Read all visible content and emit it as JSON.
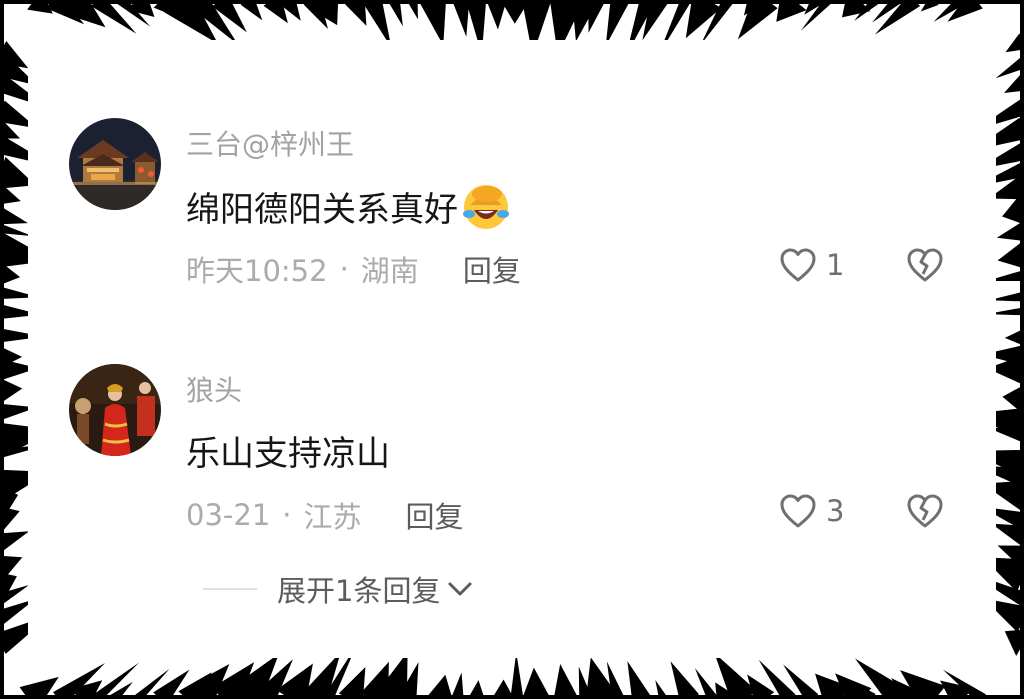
{
  "comments": [
    {
      "username": "三台@梓州王",
      "text": "绵阳德阳关系真好",
      "emoji": "face-palm-laughing-emoji",
      "time": "昨天10:52",
      "separator": "·",
      "location": "湖南",
      "reply_label": "回复",
      "likes": "1",
      "avatar": "night-ancient-tower-photo"
    },
    {
      "username": "狼头",
      "text": "乐山支持凉山",
      "time": "03-21",
      "separator": "·",
      "location": "江苏",
      "reply_label": "回复",
      "likes": "3",
      "avatar": "traditional-red-wedding-photo"
    }
  ],
  "expand_replies": {
    "label": "展开1条回复",
    "icon": "chevron-down-icon"
  },
  "icons": {
    "like": "heart-outline-icon",
    "dislike": "broken-heart-icon"
  },
  "colors": {
    "username": "#a3a3a3",
    "content": "#161616",
    "meta": "#ababab",
    "action": "#5c5c5c",
    "icon": "#707070",
    "frame": "#000000"
  }
}
